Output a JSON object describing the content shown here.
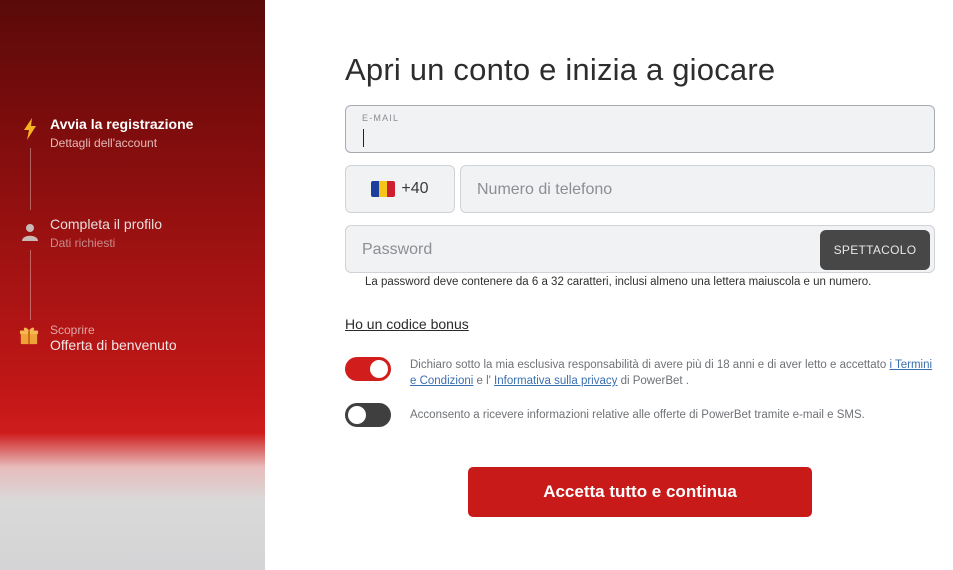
{
  "colors": {
    "brand_red": "#c91a1a",
    "toggle_on": "#d21d1d",
    "toggle_off": "#3f3f3f",
    "field_bg": "#f1f2f4",
    "link_blue": "#3a6fb0"
  },
  "sidebar": {
    "steps": [
      {
        "icon": "lightning-icon",
        "title": "Avvia la registrazione",
        "subtitle": "Dettagli dell'account"
      },
      {
        "icon": "user-icon",
        "title": "Completa il profilo",
        "subtitle": "Dati richiesti"
      },
      {
        "icon": "gift-icon",
        "pre": "Scoprire",
        "title": "Offerta di benvenuto"
      }
    ]
  },
  "main": {
    "title": "Apri un conto e inizia a giocare",
    "email": {
      "label": "E-MAIL",
      "value": ""
    },
    "phone": {
      "country_code": "+40",
      "flag": "romania-flag",
      "placeholder": "Numero di telefono"
    },
    "password": {
      "placeholder": "Password",
      "show_label": "SPETTACOLO",
      "hint": "La password deve contenere da 6 a 32 caratteri, inclusi almeno una lettera maiuscola e un numero."
    },
    "bonus_link": "Ho un codice bonus",
    "consents": [
      {
        "checked": true,
        "text_before": "Dichiaro sotto la mia esclusiva responsabilità di avere più di 18 anni e di aver letto e accettato ",
        "link1": "i Termini e Condizioni",
        "text_mid": " e l' ",
        "link2": "Informativa sulla privacy",
        "text_after": " di PowerBet ."
      },
      {
        "checked": false,
        "text": "Acconsento a ricevere informazioni relative alle offerte di PowerBet tramite e-mail e SMS."
      }
    ],
    "cta_label": "Accetta tutto e continua"
  }
}
